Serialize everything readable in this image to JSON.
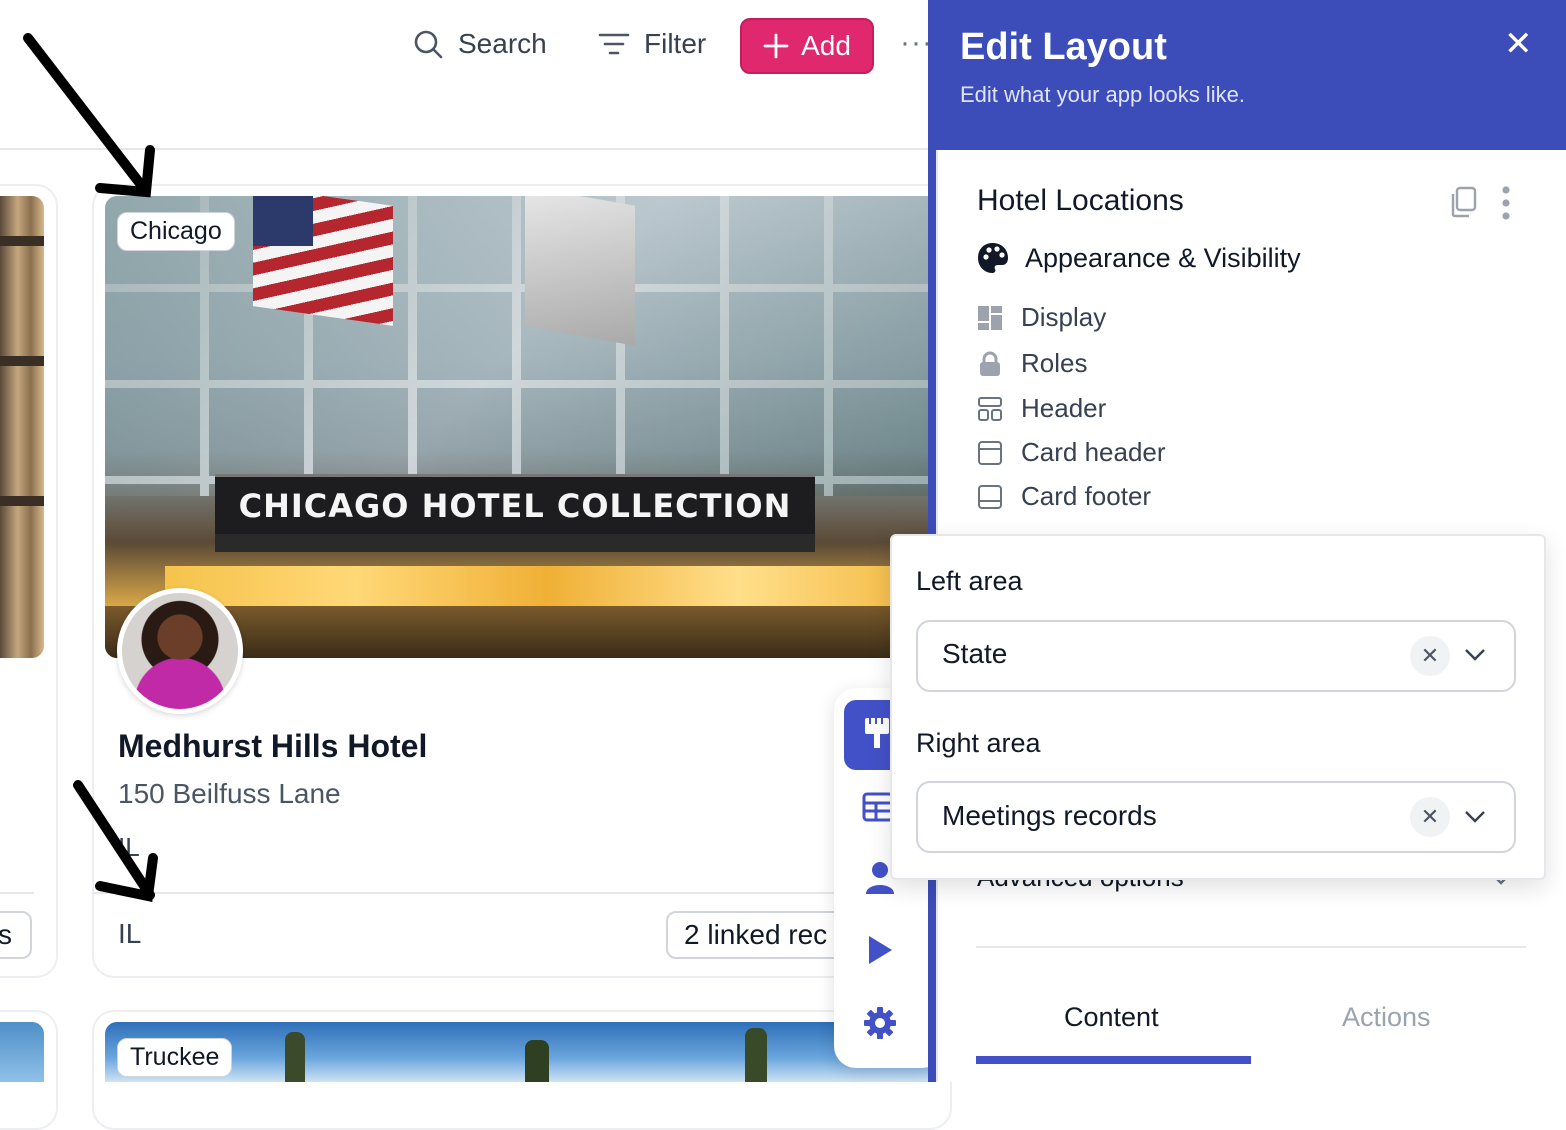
{
  "toolbar": {
    "search_label": "Search",
    "filter_label": "Filter",
    "add_label": "Add",
    "more_label": "···",
    "accent_color": "#e0286f"
  },
  "cards": [
    {
      "tag": "Chicago",
      "banner_sign": "CHICAGO HOTEL COLLECTION",
      "name": "Medhurst Hills Hotel",
      "address": "150 Beilfuss Lane",
      "field_state": "IL",
      "footer_left": "IL",
      "footer_right": "2 linked rec"
    },
    {
      "tag": "Truckee"
    }
  ],
  "left_card_partial": {
    "footer_fragment": "s"
  },
  "panel": {
    "title": "Edit Layout",
    "subtitle": "Edit what your app looks like.",
    "close_label": "✕",
    "section_title": "Hotel Locations",
    "appearance_label": "Appearance & Visibility",
    "menu": [
      {
        "label": "Display",
        "icon": "display-icon"
      },
      {
        "label": "Roles",
        "icon": "lock-icon"
      },
      {
        "label": "Header",
        "icon": "header-icon"
      },
      {
        "label": "Card header",
        "icon": "card-header-icon"
      },
      {
        "label": "Card footer",
        "icon": "card-footer-icon"
      }
    ],
    "advanced_label": "Advanced options",
    "tabs": [
      {
        "label": "Content",
        "active": true
      },
      {
        "label": "Actions",
        "active": false
      }
    ],
    "header_color": "#3c4cb8"
  },
  "popover": {
    "left_label": "Left area",
    "left_value": "State",
    "right_label": "Right area",
    "right_value": "Meetings records",
    "clear_glyph": "✕",
    "chevron_glyph": "⌄"
  },
  "rail": {
    "items": [
      "brush-icon",
      "table-icon",
      "user-icon",
      "play-icon",
      "gear-icon"
    ],
    "active_color": "#4351c8"
  }
}
